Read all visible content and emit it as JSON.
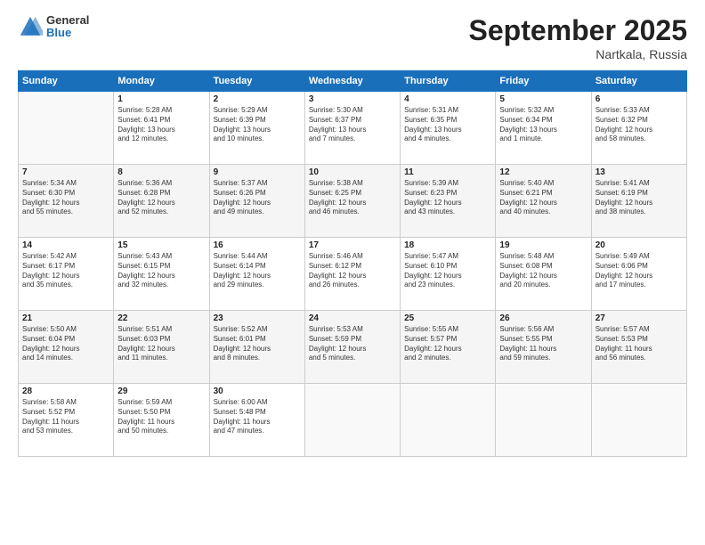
{
  "header": {
    "logo_general": "General",
    "logo_blue": "Blue",
    "month": "September 2025",
    "location": "Nartkala, Russia"
  },
  "days_of_week": [
    "Sunday",
    "Monday",
    "Tuesday",
    "Wednesday",
    "Thursday",
    "Friday",
    "Saturday"
  ],
  "weeks": [
    [
      {
        "num": "",
        "info": ""
      },
      {
        "num": "1",
        "info": "Sunrise: 5:28 AM\nSunset: 6:41 PM\nDaylight: 13 hours\nand 12 minutes."
      },
      {
        "num": "2",
        "info": "Sunrise: 5:29 AM\nSunset: 6:39 PM\nDaylight: 13 hours\nand 10 minutes."
      },
      {
        "num": "3",
        "info": "Sunrise: 5:30 AM\nSunset: 6:37 PM\nDaylight: 13 hours\nand 7 minutes."
      },
      {
        "num": "4",
        "info": "Sunrise: 5:31 AM\nSunset: 6:35 PM\nDaylight: 13 hours\nand 4 minutes."
      },
      {
        "num": "5",
        "info": "Sunrise: 5:32 AM\nSunset: 6:34 PM\nDaylight: 13 hours\nand 1 minute."
      },
      {
        "num": "6",
        "info": "Sunrise: 5:33 AM\nSunset: 6:32 PM\nDaylight: 12 hours\nand 58 minutes."
      }
    ],
    [
      {
        "num": "7",
        "info": "Sunrise: 5:34 AM\nSunset: 6:30 PM\nDaylight: 12 hours\nand 55 minutes."
      },
      {
        "num": "8",
        "info": "Sunrise: 5:36 AM\nSunset: 6:28 PM\nDaylight: 12 hours\nand 52 minutes."
      },
      {
        "num": "9",
        "info": "Sunrise: 5:37 AM\nSunset: 6:26 PM\nDaylight: 12 hours\nand 49 minutes."
      },
      {
        "num": "10",
        "info": "Sunrise: 5:38 AM\nSunset: 6:25 PM\nDaylight: 12 hours\nand 46 minutes."
      },
      {
        "num": "11",
        "info": "Sunrise: 5:39 AM\nSunset: 6:23 PM\nDaylight: 12 hours\nand 43 minutes."
      },
      {
        "num": "12",
        "info": "Sunrise: 5:40 AM\nSunset: 6:21 PM\nDaylight: 12 hours\nand 40 minutes."
      },
      {
        "num": "13",
        "info": "Sunrise: 5:41 AM\nSunset: 6:19 PM\nDaylight: 12 hours\nand 38 minutes."
      }
    ],
    [
      {
        "num": "14",
        "info": "Sunrise: 5:42 AM\nSunset: 6:17 PM\nDaylight: 12 hours\nand 35 minutes."
      },
      {
        "num": "15",
        "info": "Sunrise: 5:43 AM\nSunset: 6:15 PM\nDaylight: 12 hours\nand 32 minutes."
      },
      {
        "num": "16",
        "info": "Sunrise: 5:44 AM\nSunset: 6:14 PM\nDaylight: 12 hours\nand 29 minutes."
      },
      {
        "num": "17",
        "info": "Sunrise: 5:46 AM\nSunset: 6:12 PM\nDaylight: 12 hours\nand 26 minutes."
      },
      {
        "num": "18",
        "info": "Sunrise: 5:47 AM\nSunset: 6:10 PM\nDaylight: 12 hours\nand 23 minutes."
      },
      {
        "num": "19",
        "info": "Sunrise: 5:48 AM\nSunset: 6:08 PM\nDaylight: 12 hours\nand 20 minutes."
      },
      {
        "num": "20",
        "info": "Sunrise: 5:49 AM\nSunset: 6:06 PM\nDaylight: 12 hours\nand 17 minutes."
      }
    ],
    [
      {
        "num": "21",
        "info": "Sunrise: 5:50 AM\nSunset: 6:04 PM\nDaylight: 12 hours\nand 14 minutes."
      },
      {
        "num": "22",
        "info": "Sunrise: 5:51 AM\nSunset: 6:03 PM\nDaylight: 12 hours\nand 11 minutes."
      },
      {
        "num": "23",
        "info": "Sunrise: 5:52 AM\nSunset: 6:01 PM\nDaylight: 12 hours\nand 8 minutes."
      },
      {
        "num": "24",
        "info": "Sunrise: 5:53 AM\nSunset: 5:59 PM\nDaylight: 12 hours\nand 5 minutes."
      },
      {
        "num": "25",
        "info": "Sunrise: 5:55 AM\nSunset: 5:57 PM\nDaylight: 12 hours\nand 2 minutes."
      },
      {
        "num": "26",
        "info": "Sunrise: 5:56 AM\nSunset: 5:55 PM\nDaylight: 11 hours\nand 59 minutes."
      },
      {
        "num": "27",
        "info": "Sunrise: 5:57 AM\nSunset: 5:53 PM\nDaylight: 11 hours\nand 56 minutes."
      }
    ],
    [
      {
        "num": "28",
        "info": "Sunrise: 5:58 AM\nSunset: 5:52 PM\nDaylight: 11 hours\nand 53 minutes."
      },
      {
        "num": "29",
        "info": "Sunrise: 5:59 AM\nSunset: 5:50 PM\nDaylight: 11 hours\nand 50 minutes."
      },
      {
        "num": "30",
        "info": "Sunrise: 6:00 AM\nSunset: 5:48 PM\nDaylight: 11 hours\nand 47 minutes."
      },
      {
        "num": "",
        "info": ""
      },
      {
        "num": "",
        "info": ""
      },
      {
        "num": "",
        "info": ""
      },
      {
        "num": "",
        "info": ""
      }
    ]
  ]
}
